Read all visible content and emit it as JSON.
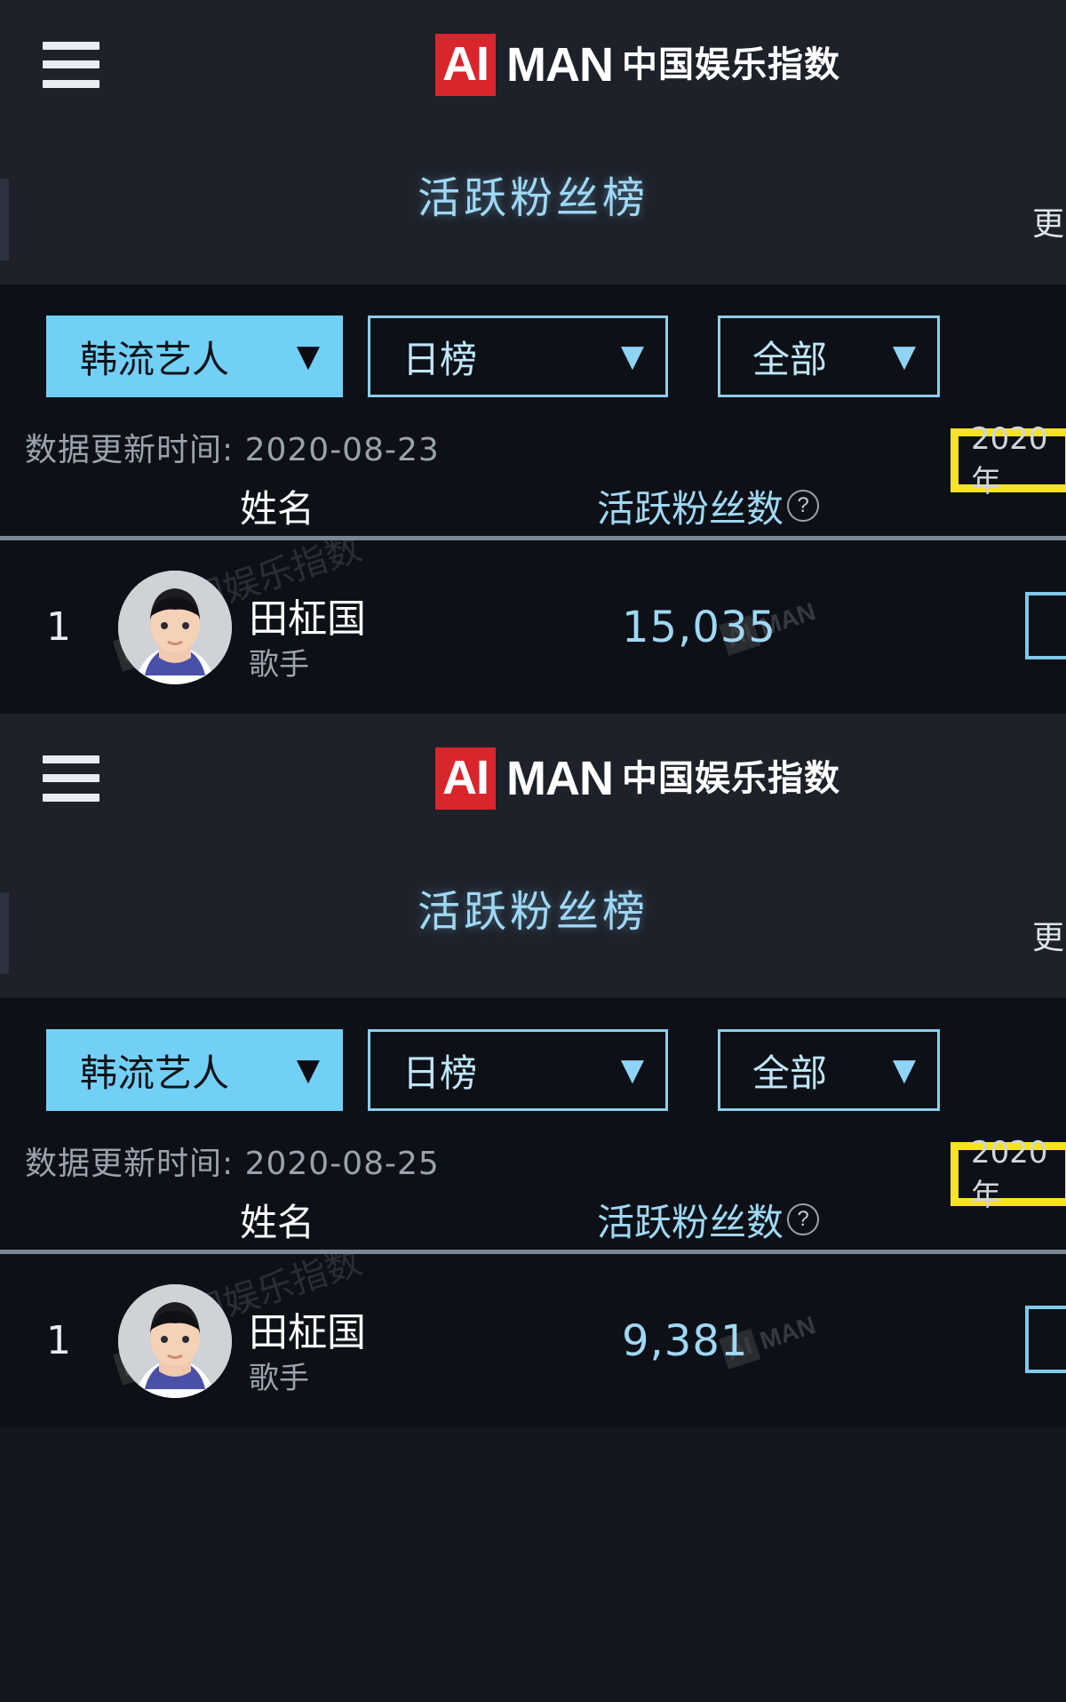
{
  "brand": {
    "logo_badge": "AI",
    "logo_word": "MAN",
    "logo_cn": "中国娱乐指数",
    "menu_icon": "hamburger-menu-icon"
  },
  "colors": {
    "accent_blue": "#72d0f7",
    "text_blue": "#9fd8f5",
    "highlight_yellow": "#f7e227",
    "logo_red": "#d8262c",
    "background": "#0d1117",
    "panel": "#1d212a"
  },
  "screens": [
    {
      "title": "活跃粉丝榜",
      "more_label": "更",
      "filters": {
        "category": {
          "label": "韩流艺人",
          "caret": "▼"
        },
        "period": {
          "label": "日榜",
          "caret": "▼"
        },
        "scope": {
          "label": "全部",
          "caret": "▼"
        }
      },
      "updated_text": "数据更新时间: 2020-08-23",
      "highlight_text": "2020年",
      "table": {
        "columns": [
          "姓名",
          "活跃粉丝数"
        ],
        "help_icon": "question-mark-icon",
        "rows": [
          {
            "rank": "1",
            "name": "田柾国",
            "role": "歌手",
            "fans": "15,035"
          }
        ]
      },
      "watermark_text": "中国娱乐指数"
    },
    {
      "title": "活跃粉丝榜",
      "more_label": "更",
      "filters": {
        "category": {
          "label": "韩流艺人",
          "caret": "▼"
        },
        "period": {
          "label": "日榜",
          "caret": "▼"
        },
        "scope": {
          "label": "全部",
          "caret": "▼"
        }
      },
      "updated_text": "数据更新时间: 2020-08-25",
      "highlight_text": "2020年",
      "table": {
        "columns": [
          "姓名",
          "活跃粉丝数"
        ],
        "help_icon": "question-mark-icon",
        "rows": [
          {
            "rank": "1",
            "name": "田柾国",
            "role": "歌手",
            "fans": "9,381"
          }
        ]
      },
      "watermark_text": "中国娱乐指数"
    }
  ]
}
